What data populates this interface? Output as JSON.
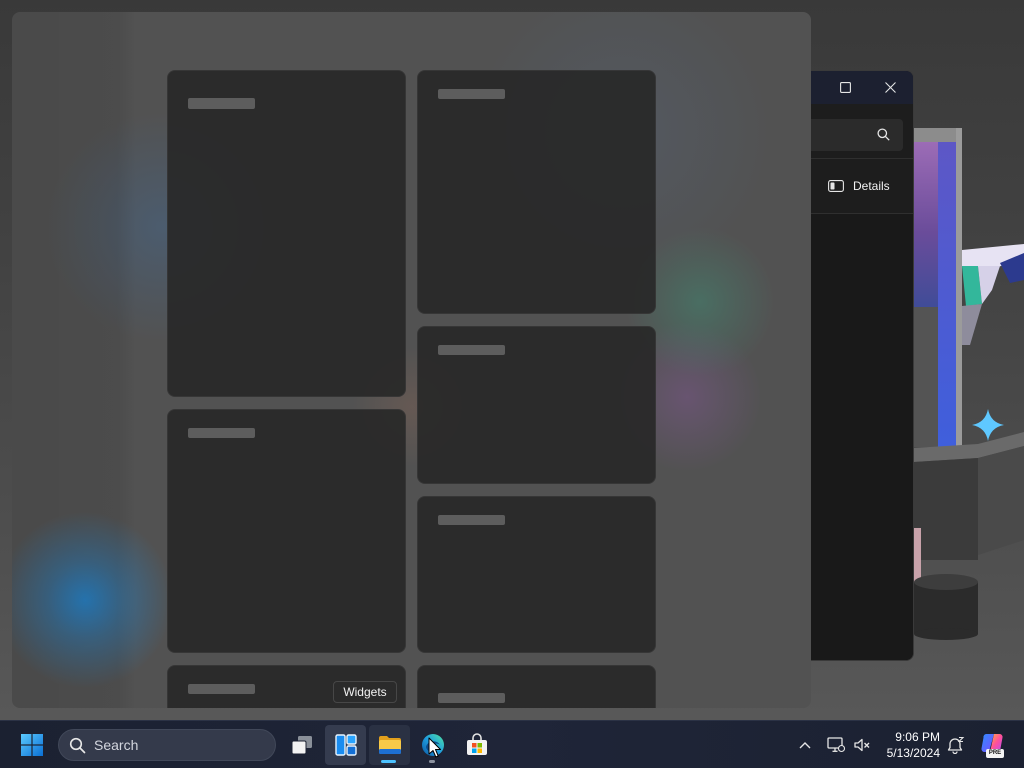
{
  "desktop": {
    "sparkle_icon": "sparkle-icon",
    "sparkle_color": "#5fc8ff"
  },
  "widgets_panel": {
    "background": "#525252",
    "card_color": "#2e2e2e",
    "placeholder_color": "#5d5d5d"
  },
  "tooltip": {
    "text": "Widgets"
  },
  "file_explorer": {
    "maximize_icon": "maximize-icon",
    "close_icon": "close-icon",
    "search_icon": "search-icon",
    "details_button": {
      "icon": "details-pane-icon",
      "label": "Details"
    }
  },
  "taskbar": {
    "background": "#1e2435",
    "start_icon": "windows-start-icon",
    "search": {
      "icon": "search-icon",
      "placeholder": "Search"
    },
    "pinned_apps": [
      {
        "icon": "task-view-icon"
      },
      {
        "icon": "widgets-icon",
        "hovered": true
      },
      {
        "icon": "file-explorer-icon",
        "active": true
      },
      {
        "icon": "edge-icon",
        "running": true
      },
      {
        "icon": "microsoft-store-icon"
      }
    ],
    "active_indicator_color": "#4cc2ff",
    "system_tray": {
      "overflow_icon": "chevron-up-icon",
      "network_icon": "network-icon",
      "volume_icon": "volume-muted-icon",
      "time": "9:06 PM",
      "date": "5/13/2024",
      "notifications_icon": "notification-bell-icon",
      "copilot": {
        "icon": "copilot-icon",
        "badge": "PRE"
      }
    }
  },
  "cursor": {
    "icon": "mouse-pointer-icon"
  }
}
